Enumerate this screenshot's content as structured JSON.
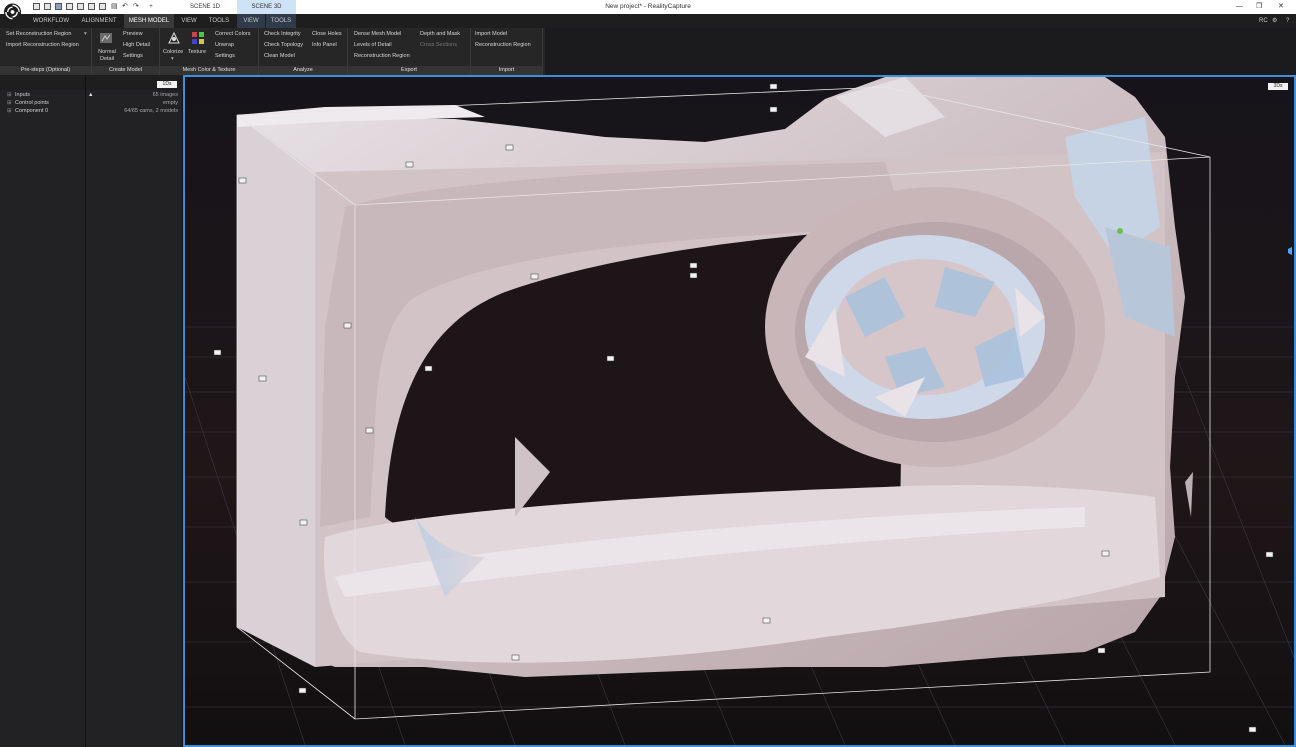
{
  "app": {
    "window_title": "New project* - RealityCapture",
    "user_badge": "RC",
    "help": "?"
  },
  "scene_tabs": {
    "plus": "+",
    "scene1d": "SCENE 1D",
    "scene3d": "SCENE 3D"
  },
  "main_tabs": [
    "WORKFLOW",
    "ALIGNMENT",
    "MESH MODEL",
    "VIEW",
    "TOOLS"
  ],
  "scene_tools": [
    "VIEW",
    "TOOLS"
  ],
  "ribbon": {
    "prestep": {
      "items": [
        "Set Reconstruction Region",
        "Import Reconstruction Region"
      ],
      "caption": "Pre-steps (Optional)"
    },
    "create": {
      "normal": "Normal",
      "detail": "Detail",
      "items": [
        "Preview",
        "High Detail",
        "Settings"
      ],
      "caption": "Create Model"
    },
    "color": {
      "colorize": "Colorize",
      "texture": "Texture",
      "items": [
        "Correct Colors",
        "Unwrap",
        "Settings"
      ],
      "caption": "Mesh Color & Texture"
    },
    "analyze": {
      "col1": [
        "Check Integrity",
        "Check Topology",
        "Clean Model"
      ],
      "col2": [
        "Close Holes",
        "Info Panel"
      ],
      "caption": "Analyze"
    },
    "export": {
      "col1": [
        "Dense Mesh Model",
        "Levels of Detail",
        "Reconstruction Region"
      ],
      "col2": [
        "Depth and Mask",
        "Cross Sections"
      ],
      "caption": "Export"
    },
    "import": {
      "items": [
        "Import Model",
        "Reconstruction Region"
      ],
      "caption": "Import"
    }
  },
  "left_panel": {
    "view_button": "1Ds",
    "tree": [
      {
        "label": "Inputs",
        "value": "65 images"
      },
      {
        "label": "Control points",
        "value": "empty"
      },
      {
        "label": "Component 0",
        "value": "64/65 cams, 2 models"
      }
    ]
  },
  "viewport": {
    "view_button": "3Ds"
  },
  "colors": {
    "accent": "#3f8fd8",
    "viewport_bg": "#171214",
    "mesh": "#d9cccf"
  }
}
